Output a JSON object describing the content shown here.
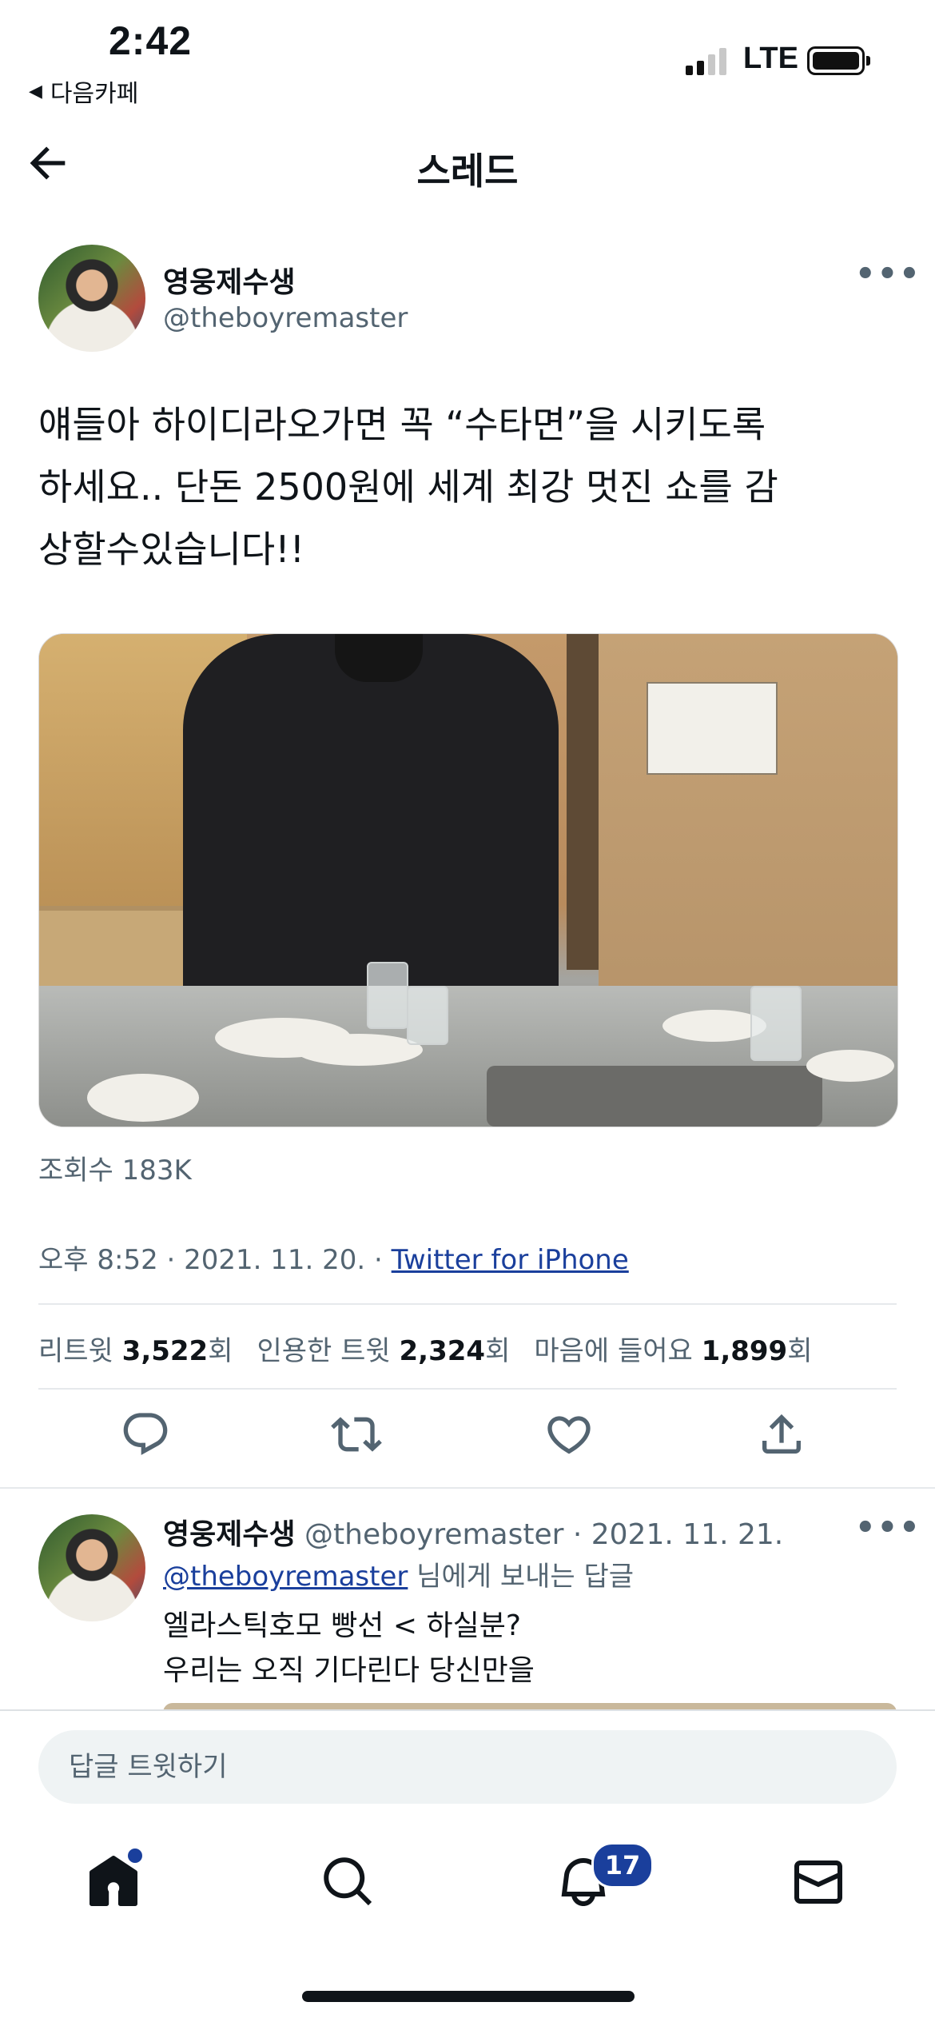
{
  "status_bar": {
    "time": "2:42",
    "back_app": "다음카페",
    "network": "LTE"
  },
  "header": {
    "title": "스레드"
  },
  "tweet": {
    "author_name": "영웅제수생",
    "author_handle": "@theboyremaster",
    "text_lines": [
      "얘들아 하이디라오가면 꼭 “수타면”을 시키도록",
      "하세요.. 단돈 2500원에 세계 최강 멋진 쇼를 감",
      "상할수있습니다!!"
    ],
    "views": "조회수 183K",
    "datetime": "오후 8:52 · 2021. 11. 20. · ",
    "source": "Twitter for iPhone",
    "stats": {
      "retweets_label": "리트윗",
      "retweets": "3,522",
      "quotes_label": "인용한 트윗",
      "quotes": "2,324",
      "likes_label": "마음에 들어요",
      "likes": "1,899",
      "unit": "회"
    }
  },
  "reply": {
    "author_name": "영웅제수생",
    "author_handle_date": " @theboyremaster · 2021. 11. 21.",
    "reply_to_mention": "@theboyremaster",
    "reply_to_suffix": " 님에게 보내는 답글",
    "text_lines": [
      "엘라스틱호모 빵선 < 하실분?",
      "우리는 오직 기다린다 당신만을"
    ]
  },
  "compose": {
    "placeholder": "답글 트윗하기"
  },
  "tabbar": {
    "notifications_badge": "17"
  },
  "colors": {
    "accent": "#1a3f9c",
    "secondary_text": "#536471",
    "primary_text": "#0f1419"
  }
}
